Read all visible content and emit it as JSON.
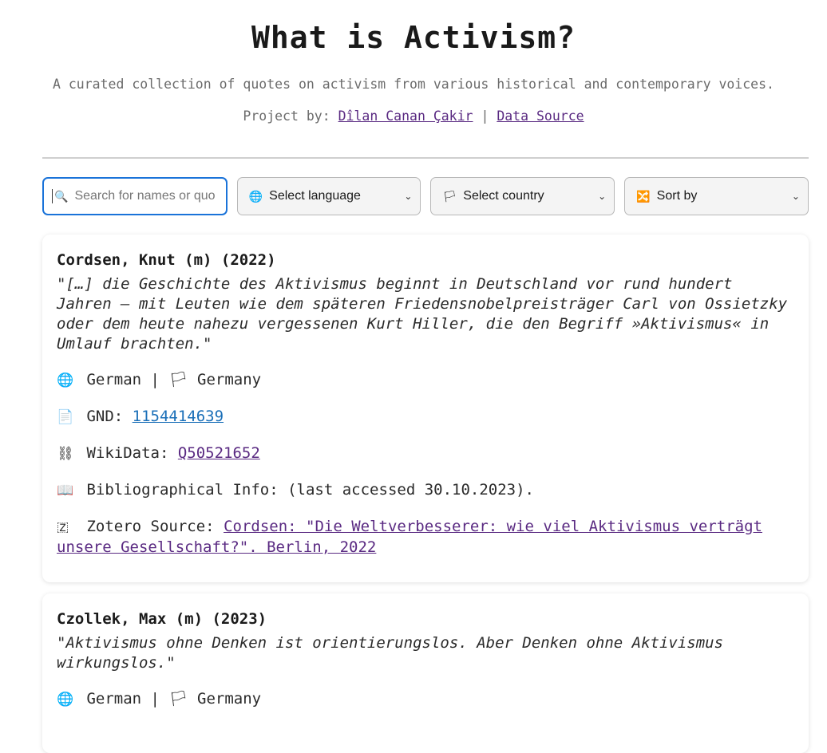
{
  "header": {
    "title": "What is Activism?",
    "subtitle": "A curated collection of quotes on activism from various historical and contemporary voices.",
    "credits_prefix": "Project by:",
    "author_link": "Dîlan Canan Çakir",
    "separator": "|",
    "data_source_link": "Data Source"
  },
  "filters": {
    "search_placeholder": "Search for names or quotes",
    "search_icon": "magnifier-icon",
    "language": {
      "icon": "🌐",
      "label": "Select language"
    },
    "country": {
      "icon": "🏳",
      "label": "Select country"
    },
    "sort": {
      "icon": "🔀",
      "label": "Sort by"
    },
    "chevron": "⌄"
  },
  "cards": [
    {
      "name": "Cordsen, Knut (m) (2022)",
      "quote": "\"[…] die Geschichte des Aktivismus beginnt in Deutschland vor rund hundert Jahren – mit Leuten wie dem späteren Friedensnobelpreisträger Carl von Ossietzky oder dem heute nahezu vergessenen Kurt Hiller, die den Begriff »Aktivismus« in Umlauf brachten.\"",
      "language": "German",
      "country": "Germany",
      "gnd_label": "GND:",
      "gnd_value": "1154414639",
      "wikidata_label": "WikiData:",
      "wikidata_value": "Q50521652",
      "biblio": "Bibliographical Info: (last accessed 30.10.2023).",
      "zotero_label": "Zotero Source:",
      "zotero_value": "Cordsen: \"Die Weltverbesserer: wie viel Aktivismus verträgt unsere Gesellschaft?\". Berlin, 2022"
    },
    {
      "name": "Czollek, Max (m) (2023)",
      "quote": "\"Aktivismus ohne Denken ist orientierungslos. Aber Denken ohne Aktivismus wirkungslos.\"",
      "language": "German",
      "country": "Germany"
    }
  ],
  "icons": {
    "globe": "🌐",
    "flag": "🏳",
    "gnd": "📄",
    "chain": "⛓",
    "book": "📖",
    "zotero": "🇿"
  }
}
